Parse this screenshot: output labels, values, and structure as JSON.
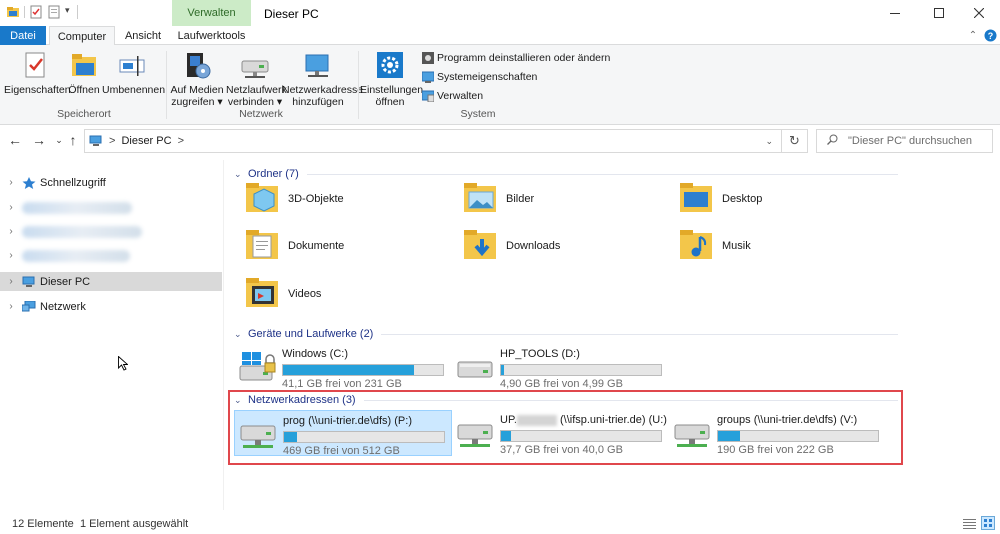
{
  "window": {
    "title": "Dieser PC",
    "context_tab": "Verwalten",
    "controls": [
      "—",
      "☐",
      "✕"
    ]
  },
  "tabs": {
    "file": "Datei",
    "computer": "Computer",
    "view": "Ansicht",
    "drive_tools": "Laufwerktools"
  },
  "ribbon": {
    "location_group": "Speicherort",
    "network_group": "Netzwerk",
    "system_group": "System",
    "properties": "Eigenschaften",
    "open": "Öffnen",
    "rename": "Umbenennen",
    "media_line1": "Auf Medien",
    "media_line2": "zugreifen ▾",
    "mapdrive_line1": "Netzlaufwerk",
    "mapdrive_line2": "verbinden ▾",
    "netloc_line1": "Netzwerkadresse",
    "netloc_line2": "hinzufügen",
    "settings_line1": "Einstellungen",
    "settings_line2": "öffnen",
    "uninstall": "Programm deinstallieren oder ändern",
    "sysprops": "Systemeigenschaften",
    "manage": "Verwalten"
  },
  "address": {
    "path": "Dieser PC",
    "separator": ">",
    "search_placeholder": "\"Dieser PC\" durchsuchen"
  },
  "nav": {
    "quick_access": "Schnellzugriff",
    "this_pc": "Dieser PC",
    "network": "Netzwerk"
  },
  "sections": {
    "folders": "Ordner (7)",
    "drives": "Geräte und Laufwerke (2)",
    "network_locations": "Netzwerkadressen (3)"
  },
  "folders": [
    {
      "name": "3D-Objekte",
      "icon": "3d-objects-folder-icon"
    },
    {
      "name": "Bilder",
      "icon": "pictures-folder-icon"
    },
    {
      "name": "Desktop",
      "icon": "desktop-folder-icon"
    },
    {
      "name": "Dokumente",
      "icon": "documents-folder-icon"
    },
    {
      "name": "Downloads",
      "icon": "downloads-folder-icon"
    },
    {
      "name": "Musik",
      "icon": "music-folder-icon"
    },
    {
      "name": "Videos",
      "icon": "videos-folder-icon"
    }
  ],
  "drives": [
    {
      "name": "Windows (C:)",
      "free": "41,1 GB frei von 231 GB",
      "used_fraction": 0.82
    },
    {
      "name": "HP_TOOLS (D:)",
      "free": "4,90 GB frei von 4,99 GB",
      "used_fraction": 0.02
    }
  ],
  "network_drives": [
    {
      "name": "prog (\\\\uni-trier.de\\dfs) (P:)",
      "free": "469 GB frei von 512 GB",
      "used_fraction": 0.08
    },
    {
      "name_prefix": "UP.",
      "name_suffix": " (\\\\ifsp.uni-trier.de) (U:)",
      "free": "37,7 GB frei von 40,0 GB",
      "used_fraction": 0.06
    },
    {
      "name": "groups (\\\\uni-trier.de\\dfs) (V:)",
      "free": "190 GB frei von 222 GB",
      "used_fraction": 0.14
    }
  ],
  "status": {
    "count": "12 Elemente",
    "selected": "1 Element ausgewählt"
  },
  "colors": {
    "accent": "#1979ca",
    "context_tab_bg": "#ccebc7",
    "bar_fill": "#26a0da",
    "selection": "#cce8ff",
    "highlight_box": "#e0474c"
  }
}
